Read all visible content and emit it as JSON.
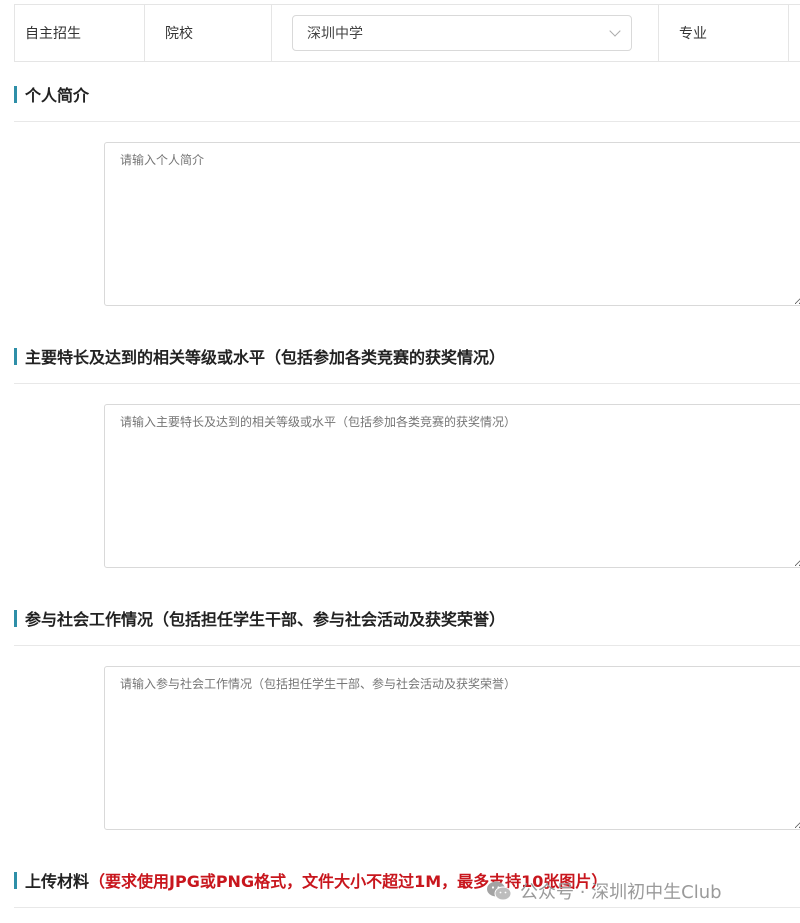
{
  "top_row": {
    "label_enrollment": "自主招生",
    "label_school": "院校",
    "school_value": "深圳中学",
    "label_major": "专业"
  },
  "sections": {
    "intro": {
      "title": "个人简介",
      "placeholder": "请输入个人简介"
    },
    "talent": {
      "title": "主要特长及达到的相关等级或水平（包括参加各类竞赛的获奖情况）",
      "placeholder": "请输入主要特长及达到的相关等级或水平（包括参加各类竞赛的获奖情况）"
    },
    "social": {
      "title": "参与社会工作情况（包括担任学生干部、参与社会活动及获奖荣誉）",
      "placeholder": "请输入参与社会工作情况（包括担任学生干部、参与社会活动及获奖荣誉）"
    },
    "upload": {
      "title": "上传材料",
      "note": "（要求使用JPG或PNG格式，文件大小不超过1M，最多支持10张图片）"
    }
  },
  "watermark": {
    "text": "公众号 · 深圳初中生Club",
    "icon": "wechat-icon"
  },
  "colors": {
    "accent_bar": "#2e8fa8",
    "warning_red": "#c8161d"
  }
}
